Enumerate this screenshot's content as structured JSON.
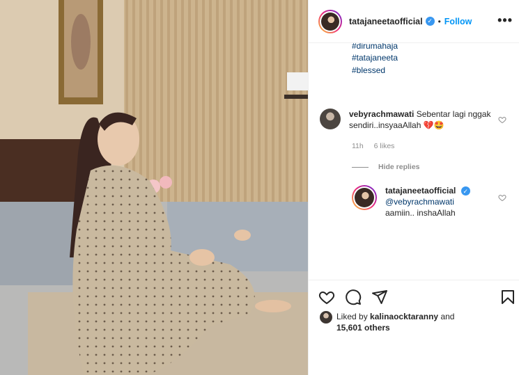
{
  "post": {
    "username": "tatajaneetaofficial",
    "separator": "•",
    "follow_label": "Follow",
    "more_label": "•••",
    "verified_mark": "✓"
  },
  "caption_hashtags": [
    "#dirumahaja",
    "#tatajaneeta",
    "#blessed"
  ],
  "comment": {
    "username": "vebyrachmawati",
    "text": "Sebentar lagi nggak sendiri..insyaaAllah 💔🤩",
    "age": "11h",
    "likes": "6 likes"
  },
  "hide_replies_label": "Hide replies",
  "reply": {
    "username": "tatajaneetaofficial",
    "mention": "@vebyrachmawati",
    "text": "aamiin.. inshaAllah"
  },
  "liked_by": {
    "prefix": "Liked by",
    "user": "kalinaocktaranny",
    "and_label": "and",
    "others": "15,601 others"
  },
  "icons": [
    "heart-icon",
    "comment-icon",
    "share-icon",
    "bookmark-icon",
    "more-icon",
    "verified-badge-icon"
  ],
  "colors": {
    "link": "#00376b",
    "follow": "#0095f6",
    "muted": "#8e8e8e",
    "verified": "#3897f0"
  }
}
